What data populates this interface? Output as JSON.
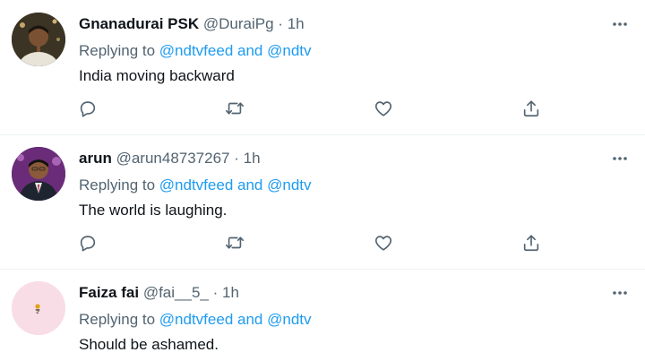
{
  "tweets": [
    {
      "name": "Gnanadurai PSK",
      "handle": "@DuraiPg",
      "separator": "·",
      "time": "1h",
      "replying_prefix": "Replying to",
      "reply_user_1": "@ndtvfeed",
      "reply_and": "and",
      "reply_user_2": "@ndtv",
      "text": "India moving backward"
    },
    {
      "name": "arun",
      "handle": "@arun48737267",
      "separator": "·",
      "time": "1h",
      "replying_prefix": "Replying to",
      "reply_user_1": "@ndtvfeed",
      "reply_and": "and",
      "reply_user_2": "@ndtv",
      "text": "The world is laughing."
    },
    {
      "name": "Faiza fai",
      "handle": "@fai__5_",
      "separator": "·",
      "time": "1h",
      "replying_prefix": "Replying to",
      "reply_user_1": "@ndtvfeed",
      "reply_and": "and",
      "reply_user_2": "@ndtv",
      "text": "Should be ashamed."
    }
  ],
  "icons": {
    "more": "more-icon",
    "reply": "reply-icon",
    "retweet": "retweet-icon",
    "like": "like-icon",
    "share": "share-icon"
  },
  "colors": {
    "link": "#1d9bf0",
    "secondary_text": "#536471",
    "primary_text": "#0f1419"
  }
}
